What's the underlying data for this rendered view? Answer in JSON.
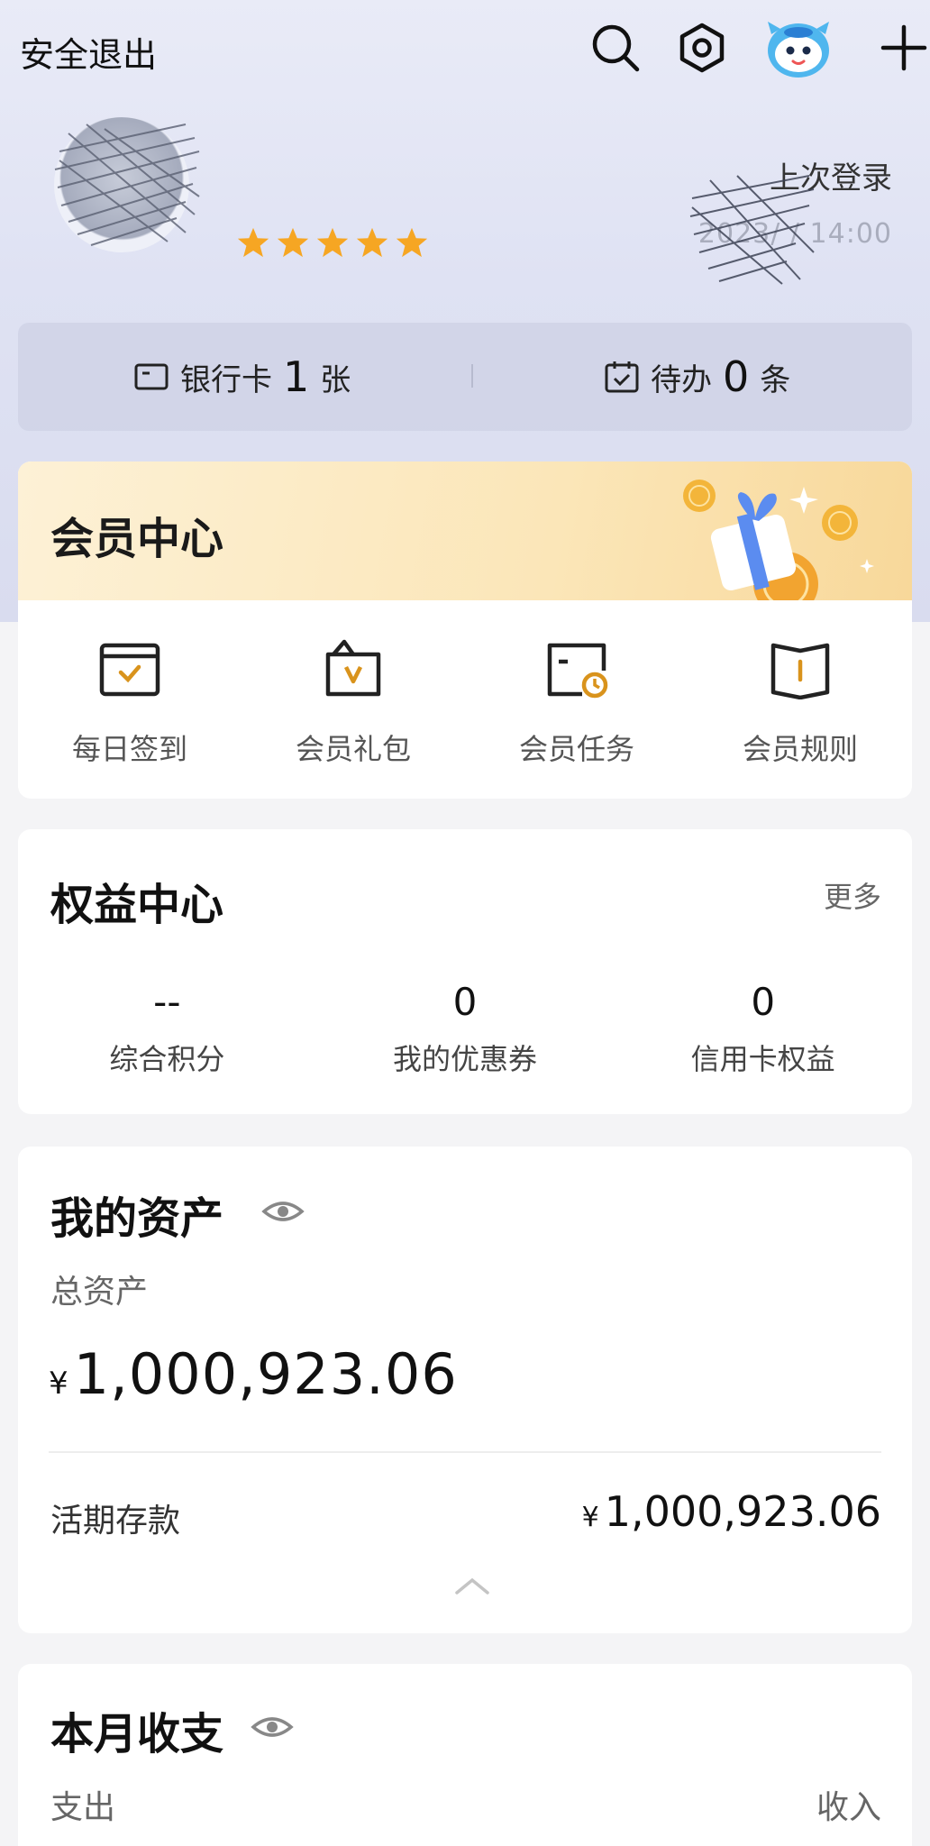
{
  "topbar": {
    "logout_label": "安全退出",
    "icons": [
      "search-icon",
      "settings-icon",
      "mascot-icon",
      "plus-icon"
    ]
  },
  "profile": {
    "rating_stars": 5,
    "last_login_label": "上次登录",
    "last_login_time": "2023/ / 14:00"
  },
  "summary": {
    "bank_card": {
      "label": "银行卡",
      "count": "1",
      "unit": "张"
    },
    "todo": {
      "label": "待办",
      "count": "0",
      "unit": "条"
    }
  },
  "member_center": {
    "title": "会员中心",
    "items": [
      {
        "label": "每日签到",
        "icon": "checkin-icon"
      },
      {
        "label": "会员礼包",
        "icon": "gift-bag-icon"
      },
      {
        "label": "会员任务",
        "icon": "task-icon"
      },
      {
        "label": "会员规则",
        "icon": "rules-book-icon"
      }
    ]
  },
  "rights_center": {
    "title": "权益中心",
    "more_label": "更多",
    "items": [
      {
        "value": "--",
        "label": "综合积分"
      },
      {
        "value": "0",
        "label": "我的优惠券"
      },
      {
        "value": "0",
        "label": "信用卡权益"
      }
    ]
  },
  "assets": {
    "title": "我的资产",
    "total_label": "总资产",
    "currency": "¥",
    "total_amount": "1,000,923.06",
    "deposit_label": "活期存款",
    "deposit_amount": "1,000,923.06"
  },
  "monthly": {
    "title": "本月收支",
    "expense_label": "支出",
    "income_label": "收入"
  },
  "colors": {
    "accent_gold": "#d9931c",
    "star": "#f6a623",
    "hero_bg": "#e4e6f5",
    "card_bg": "#ffffff"
  }
}
